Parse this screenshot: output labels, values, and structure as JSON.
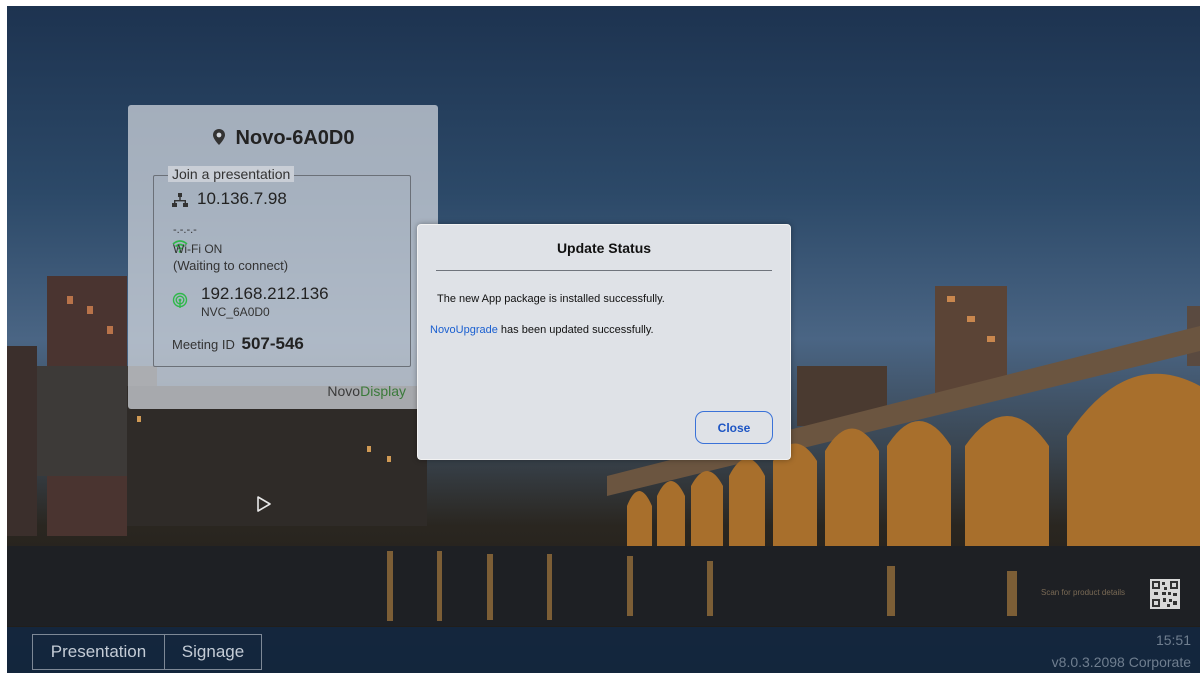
{
  "device": {
    "name": "Novo-6A0D0",
    "join_label": "Join a presentation",
    "lan_ip": "10.136.7.98",
    "wifi_ssid": "-.-.-.-",
    "wifi_status": "Wi-Fi ON",
    "wifi_substatus": "(Waiting to connect)",
    "hotspot_ip": "192.168.212.136",
    "hotspot_name": "NVC_6A0D0",
    "meeting_label": "Meeting ID",
    "meeting_id": "507-546",
    "brand_primary": "Novo",
    "brand_secondary": "Display"
  },
  "dialog": {
    "title": "Update Status",
    "message_1": "The new App package is installed successfully.",
    "message_2_link": "NovoUpgrade",
    "message_2_rest": " has been updated successfully.",
    "close_label": "Close"
  },
  "qr": {
    "label": "Scan for product details"
  },
  "bottom_bar": {
    "tabs": [
      {
        "label": "Presentation"
      },
      {
        "label": "Signage"
      }
    ],
    "time": "15:51",
    "version": "v8.0.3.2098 Corporate"
  },
  "icons": {
    "location": "location-pin-icon",
    "lan": "network-icon",
    "wifi": "wifi-icon",
    "hotspot": "hotspot-icon",
    "play": "play-cursor-icon",
    "qr": "qr-code-icon"
  },
  "colors": {
    "link": "#1a5fd0",
    "wifi_green": "#2fb84a",
    "brand_accent": "#3a7a3a",
    "bottom_bar": "#122842"
  }
}
